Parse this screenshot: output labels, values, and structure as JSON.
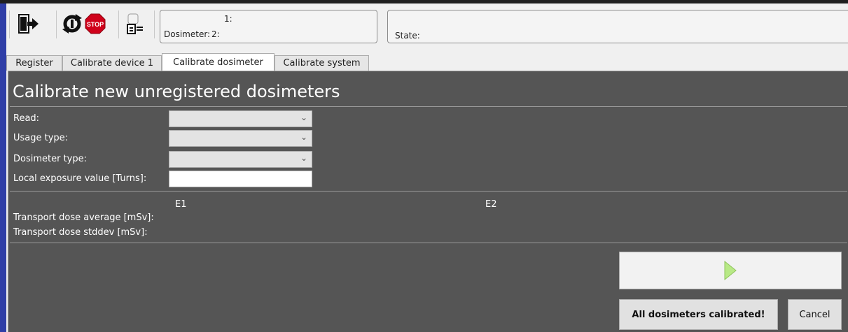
{
  "toolbar": {
    "icons": [
      "exit-icon",
      "refresh-icon",
      "stop-icon",
      "dosimeter-reader-icon"
    ],
    "dosimeter_box": {
      "line1": "1:",
      "line2_label": "Dosimeter:",
      "line2_value": "2:"
    },
    "state_box": {
      "label": "State:"
    }
  },
  "tabs": [
    {
      "label": "Register",
      "active": false
    },
    {
      "label": "Calibrate device 1",
      "active": false
    },
    {
      "label": "Calibrate dosimeter",
      "active": true
    },
    {
      "label": "Calibrate system",
      "active": false
    }
  ],
  "panel": {
    "title": "Calibrate new unregistered dosimeters",
    "form": {
      "read_label": "Read:",
      "read_value": "",
      "usage_type_label": "Usage type:",
      "usage_type_value": "",
      "dosimeter_type_label": "Dosimeter type:",
      "dosimeter_type_value": "",
      "local_exposure_label": "Local exposure value [Turns]:",
      "local_exposure_value": ""
    },
    "results": {
      "col_e1": "E1",
      "col_e2": "E2",
      "avg_label": "Transport dose average [mSv]:",
      "stddev_label": "Transport dose stddev [mSv]:"
    },
    "buttons": {
      "all_calibrated": "All dosimeters calibrated!",
      "cancel": "Cancel"
    }
  },
  "colors": {
    "panel_bg": "#555555",
    "play_green": "#b8e986",
    "stop_red": "#d0021b",
    "window_accent": "#2f3ea7"
  }
}
